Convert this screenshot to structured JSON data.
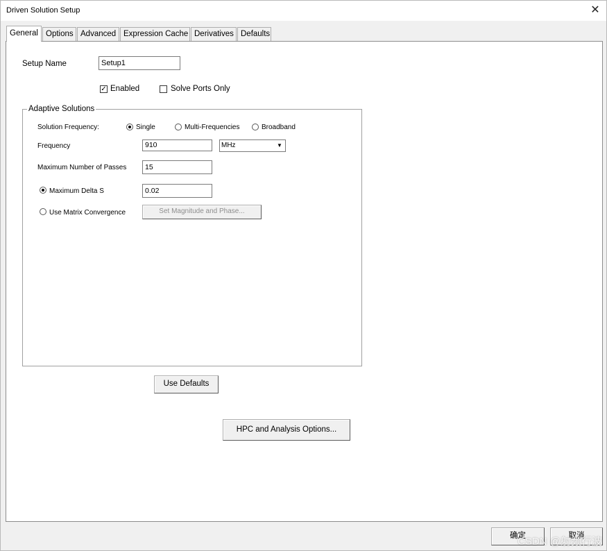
{
  "window": {
    "title": "Driven Solution Setup",
    "close_glyph": "✕"
  },
  "tabs": [
    {
      "label": "General",
      "active": true
    },
    {
      "label": "Options",
      "active": false
    },
    {
      "label": "Advanced",
      "active": false
    },
    {
      "label": "Expression Cache",
      "active": false
    },
    {
      "label": "Derivatives",
      "active": false
    },
    {
      "label": "Defaults",
      "active": false
    }
  ],
  "general": {
    "setup_name_label": "Setup Name",
    "setup_name_value": "Setup1",
    "enabled_label": "Enabled",
    "enabled_checked": true,
    "solve_ports_only_label": "Solve Ports Only",
    "solve_ports_only_checked": false,
    "check_glyph": "✓"
  },
  "adaptive": {
    "group_title": "Adaptive Solutions",
    "solution_frequency_label": "Solution Frequency:",
    "options": [
      "Single",
      "Multi-Frequencies",
      "Broadband"
    ],
    "selected_option": "Single",
    "frequency_label": "Frequency",
    "frequency_value": "910",
    "frequency_unit": "MHz",
    "max_passes_label": "Maximum Number of Passes",
    "max_passes_value": "15",
    "max_delta_s_label": "Maximum Delta S",
    "max_delta_s_value": "0.02",
    "use_matrix_label": "Use Matrix Convergence",
    "set_mag_phase_label": "Set Magnitude and Phase..."
  },
  "buttons": {
    "use_defaults": "Use Defaults",
    "hpc_options": "HPC and Analysis Options...",
    "ok": "确定",
    "cancel": "取消"
  },
  "watermark": "CSDN @射频行波"
}
